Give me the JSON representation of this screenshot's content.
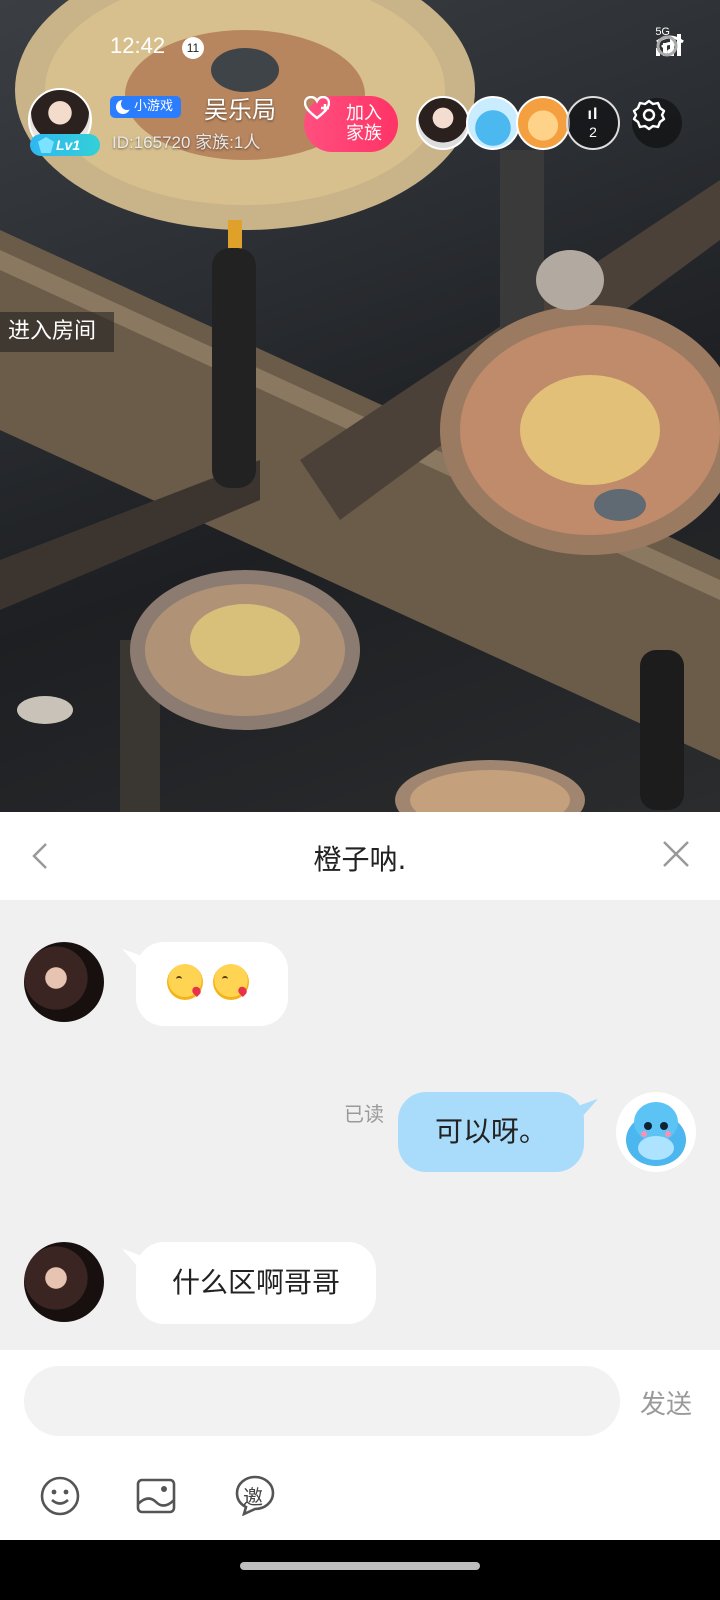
{
  "status_bar": {
    "time": "12:42",
    "notification_count": "11",
    "network": "5G"
  },
  "room": {
    "tag": "小游戏",
    "name": "吴乐局",
    "id_text": "ID:165720  家族:1人",
    "level": "Lv1",
    "join_label": "加入家族",
    "viewer_count": "2"
  },
  "notice": {
    "text": "进入房间"
  },
  "chat": {
    "title": "橙子呐.",
    "messages": [
      {
        "side": "left",
        "type": "emoji",
        "content": "😘😘"
      },
      {
        "side": "right",
        "type": "text",
        "content": "可以呀。",
        "status": "已读"
      },
      {
        "side": "left",
        "type": "text",
        "content": "什么区啊哥哥"
      }
    ],
    "input_placeholder": "",
    "send_label": "发送",
    "invite_glyph": "邀"
  },
  "icons": [
    "back-icon",
    "close-icon",
    "settings-icon",
    "emoji-icon",
    "image-icon",
    "invite-icon",
    "wifi-icon",
    "signal-icon"
  ]
}
